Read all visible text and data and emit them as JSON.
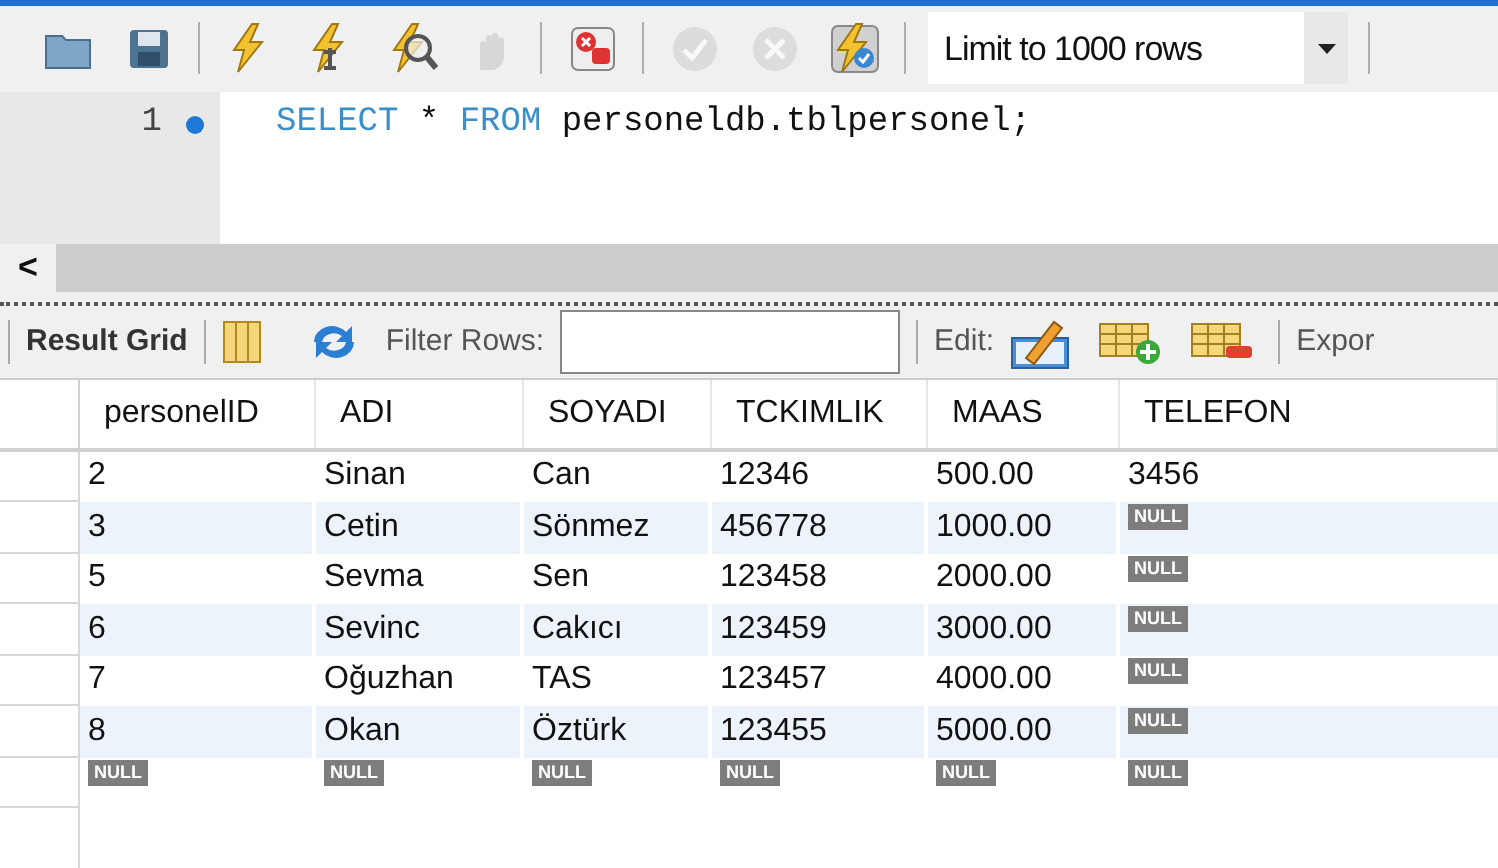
{
  "toolbar": {
    "buttons": [
      {
        "kind": "open",
        "disabled": false
      },
      {
        "kind": "save",
        "disabled": false
      },
      {
        "kind": "execute",
        "disabled": false
      },
      {
        "kind": "execute-current",
        "disabled": false
      },
      {
        "kind": "explain",
        "disabled": false
      },
      {
        "kind": "stop",
        "disabled": true
      },
      {
        "kind": "toggle-stop",
        "disabled": false
      },
      {
        "kind": "commit",
        "disabled": true
      },
      {
        "kind": "rollback",
        "disabled": true
      },
      {
        "kind": "autocommit",
        "disabled": false
      }
    ],
    "limit": "Limit to 1000 rows"
  },
  "editor": {
    "lines": [
      {
        "number": "1",
        "tokens": [
          {
            "kind": "keyword",
            "text": "SELECT"
          },
          {
            "kind": "plain",
            "text": "*"
          },
          {
            "kind": "keyword",
            "text": "FROM"
          },
          {
            "kind": "plain",
            "text": "personeldb.tblpersonel;"
          }
        ]
      }
    ]
  },
  "scrollbar": {
    "arrow": "<"
  },
  "result_toolbar": {
    "tab": "Result Grid",
    "filter_label": "Filter Rows:",
    "edit_label": "Edit:",
    "export_label": "Expor"
  },
  "table": {
    "columns": [
      "personelID",
      "ADI",
      "SOYADI",
      "TCKIMLIK",
      "MAAS",
      "TELEFON"
    ],
    "rows": [
      [
        {
          "kind": "value",
          "text": "2"
        },
        {
          "kind": "value",
          "text": "Sinan"
        },
        {
          "kind": "value",
          "text": "Can"
        },
        {
          "kind": "value",
          "text": "12346"
        },
        {
          "kind": "value",
          "text": "500.00"
        },
        {
          "kind": "value",
          "text": "3456"
        }
      ],
      [
        {
          "kind": "value",
          "text": "3"
        },
        {
          "kind": "value",
          "text": "Cetin"
        },
        {
          "kind": "value",
          "text": "Sönmez"
        },
        {
          "kind": "value",
          "text": "456778"
        },
        {
          "kind": "value",
          "text": "1000.00"
        },
        {
          "kind": "null",
          "text": "NULL"
        }
      ],
      [
        {
          "kind": "value",
          "text": "5"
        },
        {
          "kind": "value",
          "text": "Sevma"
        },
        {
          "kind": "value",
          "text": "Sen"
        },
        {
          "kind": "value",
          "text": "123458"
        },
        {
          "kind": "value",
          "text": "2000.00"
        },
        {
          "kind": "null",
          "text": "NULL"
        }
      ],
      [
        {
          "kind": "value",
          "text": "6"
        },
        {
          "kind": "value",
          "text": "Sevinc"
        },
        {
          "kind": "value",
          "text": "Cakıcı"
        },
        {
          "kind": "value",
          "text": "123459"
        },
        {
          "kind": "value",
          "text": "3000.00"
        },
        {
          "kind": "null",
          "text": "NULL"
        }
      ],
      [
        {
          "kind": "value",
          "text": "7"
        },
        {
          "kind": "value",
          "text": "Oğuzhan"
        },
        {
          "kind": "value",
          "text": "TAS"
        },
        {
          "kind": "value",
          "text": "123457"
        },
        {
          "kind": "value",
          "text": "4000.00"
        },
        {
          "kind": "null",
          "text": "NULL"
        }
      ],
      [
        {
          "kind": "value",
          "text": "8"
        },
        {
          "kind": "value",
          "text": "Okan"
        },
        {
          "kind": "value",
          "text": "Öztürk"
        },
        {
          "kind": "value",
          "text": "123455"
        },
        {
          "kind": "value",
          "text": "5000.00"
        },
        {
          "kind": "null",
          "text": "NULL"
        }
      ],
      [
        {
          "kind": "null",
          "text": "NULL"
        },
        {
          "kind": "null",
          "text": "NULL"
        },
        {
          "kind": "null",
          "text": "NULL"
        },
        {
          "kind": "null",
          "text": "NULL"
        },
        {
          "kind": "null",
          "text": "NULL"
        },
        {
          "kind": "null",
          "text": "NULL"
        }
      ]
    ]
  }
}
